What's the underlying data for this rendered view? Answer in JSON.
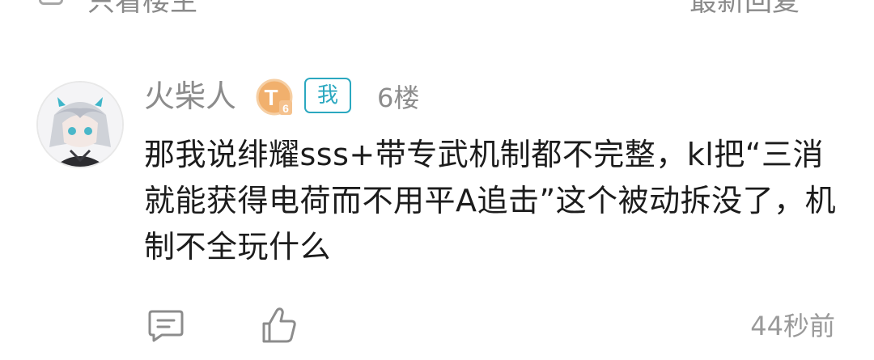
{
  "filter_bar": {
    "only_owner_label": "只看楼主",
    "sort_label": "最新回复",
    "checkbox_icon": "checkbox-icon",
    "sort_icon": "chevron-down-icon"
  },
  "comment": {
    "username": "火柴人",
    "level_badge_letter": "T",
    "level_badge_number": "6",
    "me_badge": "我",
    "floor": "6楼",
    "text": "那我说绯耀sss+带专武机制都不完整，kl把“三消就能获得电荷而不用平A追击”这个被动拆没了，机制不全玩什么",
    "time": "44秒前",
    "reply_icon": "comment-icon",
    "like_icon": "thumbs-up-icon"
  },
  "colors": {
    "accent": "#2ba8c0",
    "badge_orange": "#f0a35a",
    "muted_text": "#8c8c8c"
  }
}
